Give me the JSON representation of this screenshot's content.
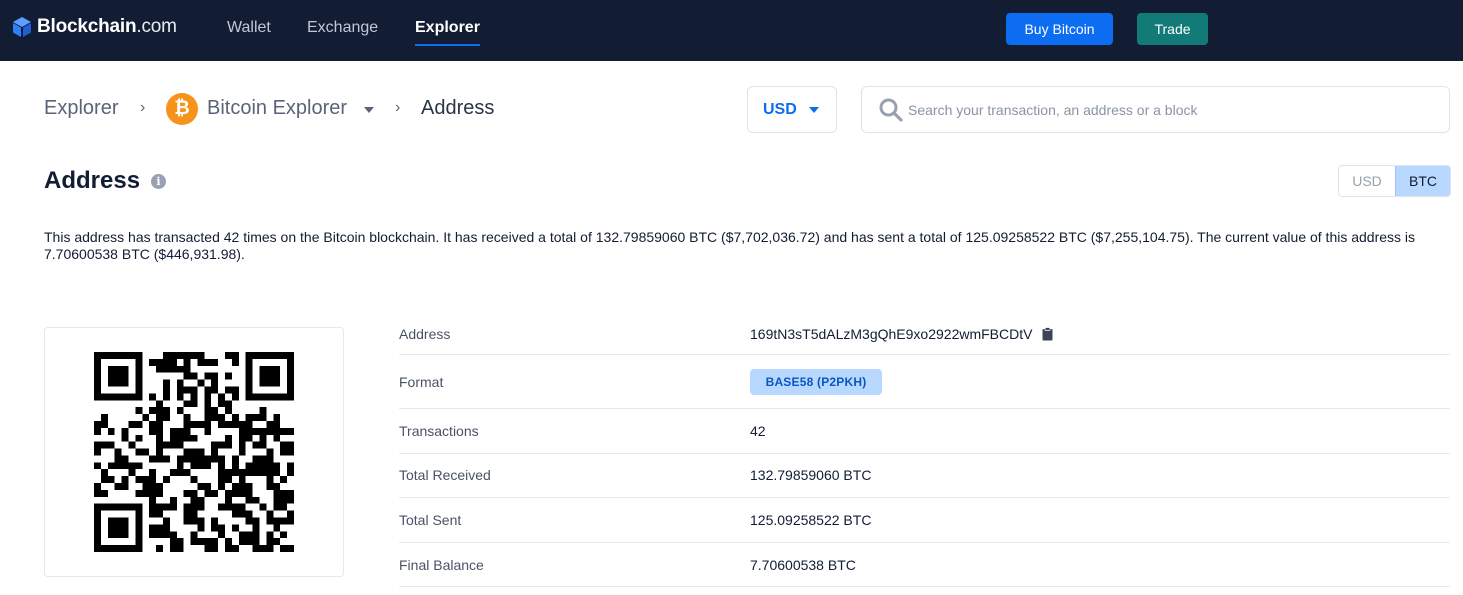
{
  "brand": {
    "name": "Blockchain",
    "suffix": ".com"
  },
  "nav": {
    "items": [
      {
        "label": "Wallet",
        "active": false
      },
      {
        "label": "Exchange",
        "active": false
      },
      {
        "label": "Explorer",
        "active": true
      }
    ],
    "buy_label": "Buy Bitcoin",
    "trade_label": "Trade"
  },
  "breadcrumb": {
    "root": "Explorer",
    "coin": "Bitcoin Explorer",
    "coin_symbol": "₿",
    "current": "Address"
  },
  "currency_select": {
    "value": "USD"
  },
  "search": {
    "placeholder": "Search your transaction, an address or a block",
    "value": ""
  },
  "page": {
    "title": "Address",
    "info_glyph": "i",
    "unit_toggle": {
      "options": [
        "USD",
        "BTC"
      ],
      "selected": "BTC"
    },
    "summary": "This address has transacted 42 times on the Bitcoin blockchain. It has received a total of 132.79859060 BTC ($7,702,036.72) and has sent a total of 125.09258522 BTC ($7,255,104.75). The current value of this address is 7.70600538 BTC ($446,931.98)."
  },
  "details": [
    {
      "label": "Address",
      "value": "169tN3sT5dALzM3gQhE9xo2922wmFBCDtV"
    },
    {
      "label": "Format",
      "value": "BASE58 (P2PKH)"
    },
    {
      "label": "Transactions",
      "value": "42"
    },
    {
      "label": "Total Received",
      "value": "132.79859060 BTC"
    },
    {
      "label": "Total Sent",
      "value": "125.09258522 BTC"
    },
    {
      "label": "Final Balance",
      "value": "7.70600538 BTC"
    }
  ],
  "colors": {
    "nav_bg": "#121d33",
    "accent_blue": "#0c6cf2",
    "trade_teal": "#127b78",
    "bitcoin_orange": "#f7931a",
    "badge_bg": "#b8d8ff"
  }
}
